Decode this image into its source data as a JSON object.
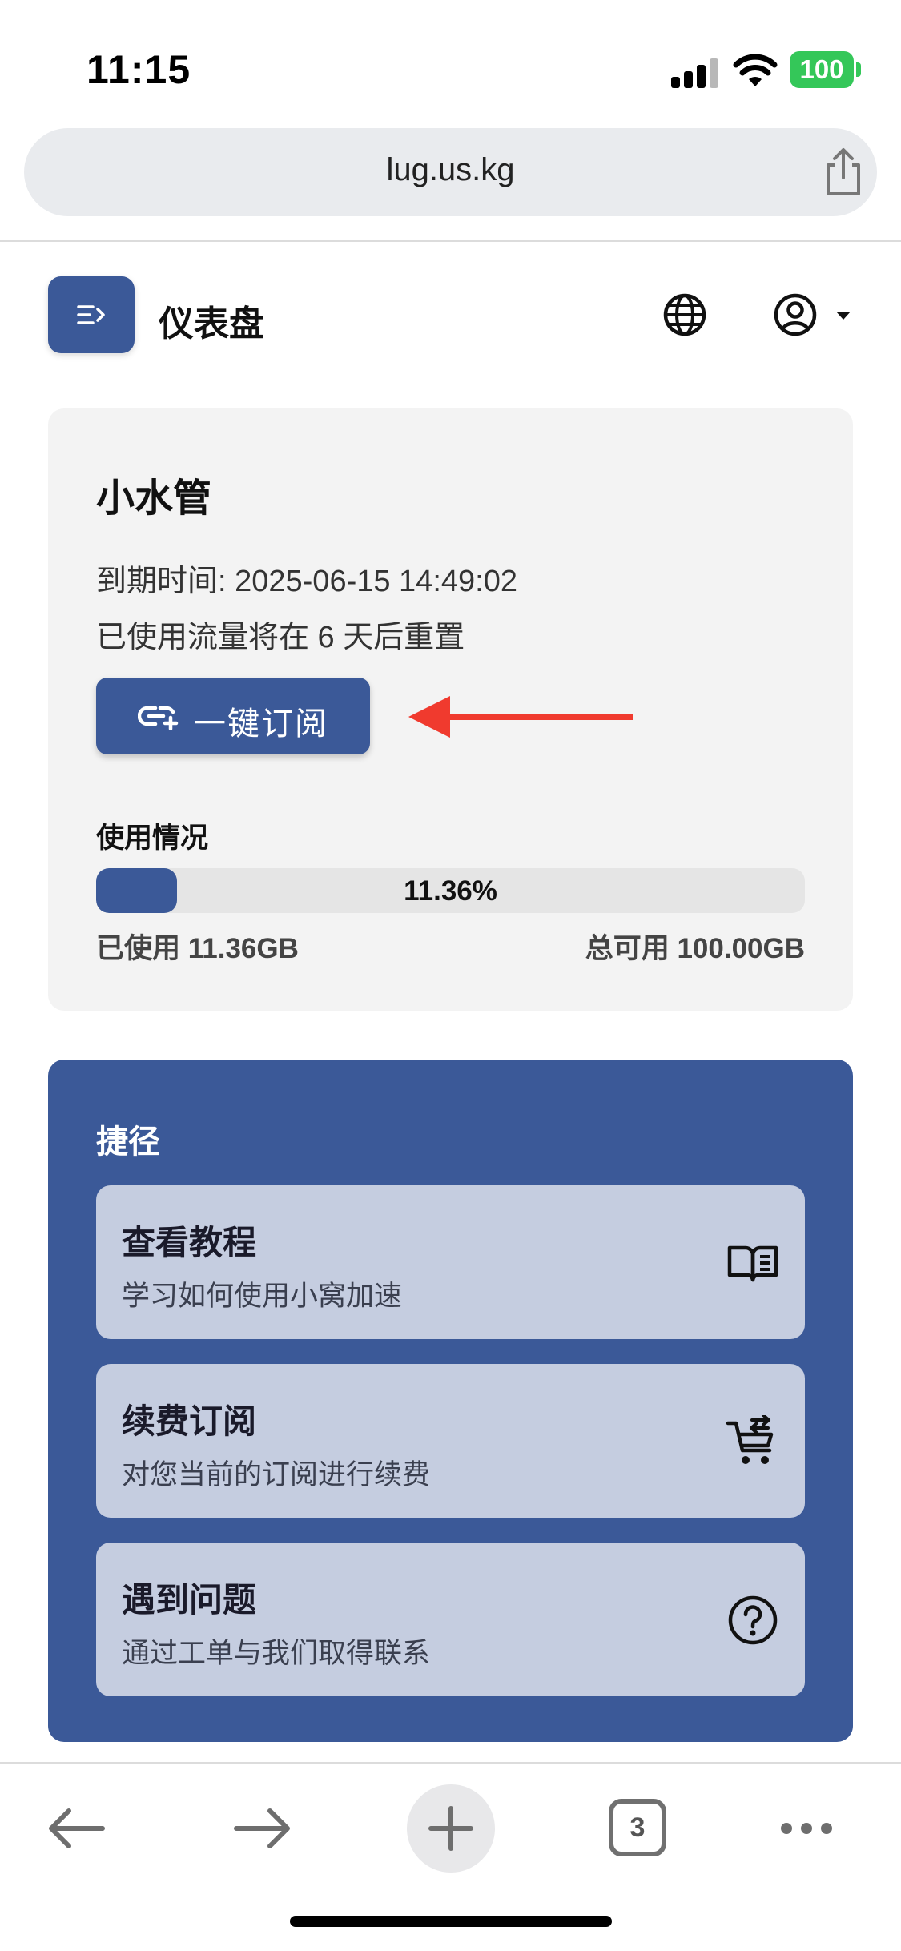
{
  "status_bar": {
    "time": "11:15",
    "battery": "100"
  },
  "browser": {
    "url": "lug.us.kg",
    "tab_count": "3"
  },
  "header": {
    "title": "仪表盘"
  },
  "subscription": {
    "name": "小水管",
    "expire_text": "到期时间: 2025-06-15 14:49:02",
    "reset_text": "已使用流量将在 6 天后重置",
    "subscribe_button": "一键订阅",
    "usage_label": "使用情况",
    "usage_percent_text": "11.36%",
    "usage_fraction": 0.1136,
    "used_text": "已使用 11.36GB",
    "total_text": "总可用 100.00GB"
  },
  "shortcuts": {
    "heading": "捷径",
    "items": [
      {
        "title": "查看教程",
        "description": "学习如何使用小窝加速",
        "icon": "book-icon"
      },
      {
        "title": "续费订阅",
        "description": "对您当前的订阅进行续费",
        "icon": "cart-icon"
      },
      {
        "title": "遇到问题",
        "description": "通过工单与我们取得联系",
        "icon": "help-icon"
      }
    ]
  },
  "colors": {
    "accent": "#3b5998",
    "annotation_arrow": "#f03a2e",
    "battery": "#34c759"
  }
}
